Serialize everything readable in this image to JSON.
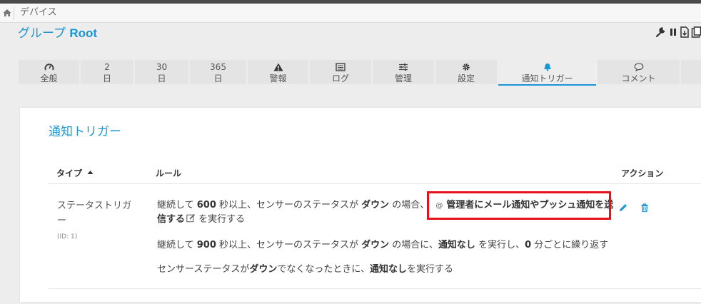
{
  "breadcrumb": {
    "home_icon": "home-icon",
    "item": "デバイス"
  },
  "header": {
    "prefix": "グループ",
    "name": "Root"
  },
  "toolbar": {
    "icons": [
      "wrench-icon",
      "pause-icon",
      "export-icon",
      "clone-icon"
    ]
  },
  "tabs": [
    {
      "top": "",
      "bottom": "全般",
      "icon": "gauge-icon"
    },
    {
      "top": "2",
      "bottom": "日"
    },
    {
      "top": "30",
      "bottom": "日"
    },
    {
      "top": "365",
      "bottom": "日"
    },
    {
      "top": "",
      "bottom": "警報",
      "icon": "warning-icon"
    },
    {
      "top": "",
      "bottom": "ログ",
      "icon": "list-icon"
    },
    {
      "top": "",
      "bottom": "管理",
      "icon": "sliders-icon"
    },
    {
      "top": "",
      "bottom": "設定",
      "icon": "gear-icon"
    },
    {
      "top": "",
      "bottom": "通知トリガー",
      "icon": "bell-icon",
      "active": true
    },
    {
      "top": "",
      "bottom": "コメント",
      "icon": "comment-icon"
    }
  ],
  "accent_color": "#1a96d4",
  "highlight_color": "#e3121b",
  "panel": {
    "title": "通知トリガー",
    "columns": {
      "type": "タイプ",
      "rule": "ルール",
      "action": "アクション"
    },
    "trigger": {
      "type_name": "ステータストリガー",
      "id_label": "(ID: 1)",
      "rules": [
        {
          "p1": "継続して ",
          "b1": "600",
          "p2": " 秒以上、センサーのステータスが ",
          "b2": "ダウン",
          "p3": " の場合、",
          "action_a": "管理者にメール通知やプッシュ通知を送",
          "action_b": "信する",
          "tail": " を実行する"
        },
        {
          "p1": "継続して ",
          "b1": "900",
          "p2": " 秒以上、センサーのステータスが ",
          "b2": "ダウン",
          "p3": " の場合に、",
          "b3": "通知なし",
          "p4": " を実行し、",
          "b4": "0",
          "p5": " 分ごとに繰り返す"
        },
        {
          "p1": "センサーステータスが",
          "b1": "ダウン",
          "p2": "でなくなったときに、",
          "b2": "通知なし",
          "p3": "を実行する"
        }
      ],
      "actions": [
        "edit-pencil-icon",
        "delete-trash-icon"
      ]
    }
  }
}
